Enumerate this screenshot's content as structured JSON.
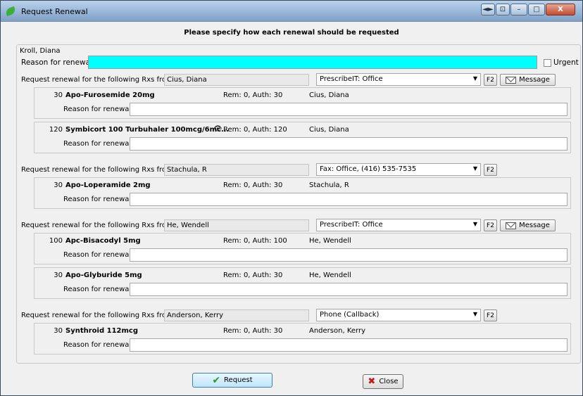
{
  "window": {
    "title": "Request Renewal",
    "min": "–",
    "max": "□",
    "close": "X",
    "extra1": "◄►",
    "extra2": "⊡"
  },
  "heading": "Please specify how each renewal should be requested",
  "patient": {
    "name": "Kroll, Diana",
    "reason_label": "Reason for renewal",
    "urgent_label": "Urgent"
  },
  "group_label": "Request renewal for the following Rxs from",
  "rx_reason_label": "Reason for renewal",
  "f2_label": "F2",
  "message_label": "Message",
  "groups": [
    {
      "prescriber": "Cius, Diana",
      "method": "PrescribeIT: Office",
      "rxs": [
        {
          "qty": "30",
          "drug": "Apo-Furosemide 20mg",
          "rem": "Rem: 0, Auth: 30",
          "prescriber": "Cius, Diana"
        },
        {
          "qty": "120",
          "drug": "Symbicort 100 Turbuhaler 100mcg/6mc...",
          "rem": "Rem: 0, Auth: 120",
          "prescriber": "Cius, Diana"
        }
      ]
    },
    {
      "prescriber": "Stachula, R",
      "method": "Fax: Office, (416) 535-7535",
      "rxs": [
        {
          "qty": "30",
          "drug": "Apo-Loperamide 2mg",
          "rem": "Rem: 0, Auth: 30",
          "prescriber": "Stachula, R"
        }
      ]
    },
    {
      "prescriber": "He, Wendell",
      "method": "PrescribeIT: Office",
      "rxs": [
        {
          "qty": "100",
          "drug": "Apc-Bisacodyl 5mg",
          "rem": "Rem: 0, Auth: 100",
          "prescriber": "He, Wendell"
        },
        {
          "qty": "30",
          "drug": "Apo-Glyburide 5mg",
          "rem": "Rem: 0, Auth: 30",
          "prescriber": "He, Wendell"
        }
      ]
    },
    {
      "prescriber": "Anderson, Kerry",
      "method": "Phone (Callback)",
      "rxs": [
        {
          "qty": "30",
          "drug": "Synthroid 112mcg",
          "rem": "Rem: 0, Auth: 30",
          "prescriber": "Anderson, Kerry"
        }
      ]
    }
  ],
  "buttons": {
    "request": "Request",
    "close": "Close"
  },
  "colors": {
    "reason_highlight": "#00ffff"
  }
}
